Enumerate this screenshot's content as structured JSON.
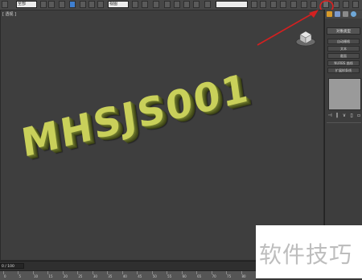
{
  "toolbar": {
    "selection_filter": "全部",
    "coord_system": "视图",
    "named_selection": ""
  },
  "viewport": {
    "label": "[ 透视 ]",
    "text_object": "MHSJS001"
  },
  "command_panel": {
    "title": "对象类型",
    "rows": [
      "自动栅格",
      "文本",
      "截面",
      "NURBS 曲线",
      "扩展样条线"
    ]
  },
  "statusbar": {
    "frame_counter": "0 / 100",
    "ticks": [
      "0",
      "5",
      "10",
      "15",
      "20",
      "25",
      "30",
      "35",
      "40",
      "45",
      "50",
      "55",
      "60",
      "65",
      "70",
      "75",
      "80"
    ]
  },
  "watermark": {
    "text": "软件技巧"
  },
  "colors": {
    "text3d_face": "#c9d05a",
    "arrow": "#d42020",
    "highlight_circle": "#e02020"
  }
}
